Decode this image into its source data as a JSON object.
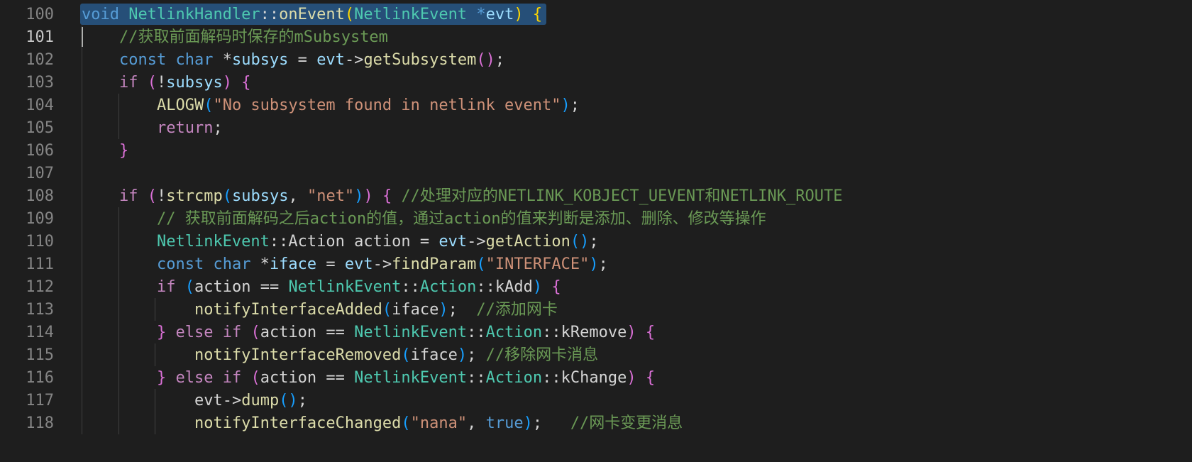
{
  "theme": {
    "background": "#1e1e1e",
    "line_number": "#858585",
    "line_number_active": "#c6c6c6",
    "selection": "#264f78",
    "keyword": "#569cd6",
    "control": "#c586c0",
    "type": "#4ec9b0",
    "function": "#dcdcaa",
    "variable": "#9cdcfe",
    "string": "#ce9178",
    "comment": "#6a9955",
    "bracket_1": "#ffd700",
    "bracket_2": "#da70d6",
    "bracket_3": "#179fff"
  },
  "editor": {
    "active_line": "101",
    "selected_line": "100",
    "lines": [
      {
        "number": "100",
        "tokens": [
          {
            "t": "void",
            "c": "kw"
          },
          {
            "t": " ",
            "c": "pl"
          },
          {
            "t": "NetlinkHandler",
            "c": "ty"
          },
          {
            "t": "::",
            "c": "pl"
          },
          {
            "t": "onEvent",
            "c": "fn"
          },
          {
            "t": "(",
            "c": "b1"
          },
          {
            "t": "NetlinkEvent",
            "c": "ty"
          },
          {
            "t": " ",
            "c": "pl"
          },
          {
            "t": "*",
            "c": "kw"
          },
          {
            "t": "evt",
            "c": "id"
          },
          {
            "t": ")",
            "c": "b1"
          },
          {
            "t": " ",
            "c": "pl"
          },
          {
            "t": "{",
            "c": "b1"
          }
        ]
      },
      {
        "number": "101",
        "tokens": [
          {
            "t": "    ",
            "c": "pl"
          },
          {
            "t": "//获取前面解码时保存的mSubsystem",
            "c": "com"
          }
        ]
      },
      {
        "number": "102",
        "tokens": [
          {
            "t": "    ",
            "c": "pl"
          },
          {
            "t": "const",
            "c": "kw"
          },
          {
            "t": " ",
            "c": "pl"
          },
          {
            "t": "char",
            "c": "kw"
          },
          {
            "t": " *",
            "c": "pl"
          },
          {
            "t": "subsys",
            "c": "id"
          },
          {
            "t": " = ",
            "c": "pl"
          },
          {
            "t": "evt",
            "c": "id"
          },
          {
            "t": "->",
            "c": "pl"
          },
          {
            "t": "getSubsystem",
            "c": "fn"
          },
          {
            "t": "()",
            "c": "b2"
          },
          {
            "t": ";",
            "c": "pl"
          }
        ]
      },
      {
        "number": "103",
        "tokens": [
          {
            "t": "    ",
            "c": "pl"
          },
          {
            "t": "if",
            "c": "ctl"
          },
          {
            "t": " ",
            "c": "pl"
          },
          {
            "t": "(",
            "c": "b2"
          },
          {
            "t": "!",
            "c": "pl"
          },
          {
            "t": "subsys",
            "c": "id"
          },
          {
            "t": ")",
            "c": "b2"
          },
          {
            "t": " ",
            "c": "pl"
          },
          {
            "t": "{",
            "c": "b2"
          }
        ]
      },
      {
        "number": "104",
        "tokens": [
          {
            "t": "        ",
            "c": "pl"
          },
          {
            "t": "ALOGW",
            "c": "fn"
          },
          {
            "t": "(",
            "c": "b3"
          },
          {
            "t": "\"No subsystem found in netlink event\"",
            "c": "str"
          },
          {
            "t": ")",
            "c": "b3"
          },
          {
            "t": ";",
            "c": "pl"
          }
        ]
      },
      {
        "number": "105",
        "tokens": [
          {
            "t": "        ",
            "c": "pl"
          },
          {
            "t": "return",
            "c": "ctl"
          },
          {
            "t": ";",
            "c": "pl"
          }
        ]
      },
      {
        "number": "106",
        "tokens": [
          {
            "t": "    ",
            "c": "pl"
          },
          {
            "t": "}",
            "c": "b2"
          }
        ]
      },
      {
        "number": "107",
        "tokens": []
      },
      {
        "number": "108",
        "tokens": [
          {
            "t": "    ",
            "c": "pl"
          },
          {
            "t": "if",
            "c": "ctl"
          },
          {
            "t": " ",
            "c": "pl"
          },
          {
            "t": "(",
            "c": "b2"
          },
          {
            "t": "!",
            "c": "pl"
          },
          {
            "t": "strcmp",
            "c": "fn"
          },
          {
            "t": "(",
            "c": "b3"
          },
          {
            "t": "subsys",
            "c": "id"
          },
          {
            "t": ", ",
            "c": "pl"
          },
          {
            "t": "\"net\"",
            "c": "str"
          },
          {
            "t": ")",
            "c": "b3"
          },
          {
            "t": ")",
            "c": "b2"
          },
          {
            "t": " ",
            "c": "pl"
          },
          {
            "t": "{",
            "c": "b2"
          },
          {
            "t": " ",
            "c": "pl"
          },
          {
            "t": "//处理对应的NETLINK_KOBJECT_UEVENT和NETLINK_ROUTE",
            "c": "com"
          }
        ]
      },
      {
        "number": "109",
        "tokens": [
          {
            "t": "        ",
            "c": "pl"
          },
          {
            "t": "// 获取前面解码之后action的值，通过action的值来判断是添加、删除、修改等操作",
            "c": "com"
          }
        ]
      },
      {
        "number": "110",
        "tokens": [
          {
            "t": "        ",
            "c": "pl"
          },
          {
            "t": "NetlinkEvent",
            "c": "ty"
          },
          {
            "t": "::",
            "c": "pl"
          },
          {
            "t": "Action",
            "c": "pl"
          },
          {
            "t": " ",
            "c": "pl"
          },
          {
            "t": "action",
            "c": "pl"
          },
          {
            "t": " = ",
            "c": "pl"
          },
          {
            "t": "evt",
            "c": "id"
          },
          {
            "t": "->",
            "c": "pl"
          },
          {
            "t": "getAction",
            "c": "fn"
          },
          {
            "t": "()",
            "c": "b3"
          },
          {
            "t": ";",
            "c": "pl"
          }
        ]
      },
      {
        "number": "111",
        "tokens": [
          {
            "t": "        ",
            "c": "pl"
          },
          {
            "t": "const",
            "c": "kw"
          },
          {
            "t": " ",
            "c": "pl"
          },
          {
            "t": "char",
            "c": "kw"
          },
          {
            "t": " *",
            "c": "pl"
          },
          {
            "t": "iface",
            "c": "id"
          },
          {
            "t": " = ",
            "c": "pl"
          },
          {
            "t": "evt",
            "c": "id"
          },
          {
            "t": "->",
            "c": "pl"
          },
          {
            "t": "findParam",
            "c": "fn"
          },
          {
            "t": "(",
            "c": "b3"
          },
          {
            "t": "\"INTERFACE\"",
            "c": "str"
          },
          {
            "t": ")",
            "c": "b3"
          },
          {
            "t": ";",
            "c": "pl"
          }
        ]
      },
      {
        "number": "112",
        "tokens": [
          {
            "t": "        ",
            "c": "pl"
          },
          {
            "t": "if",
            "c": "ctl"
          },
          {
            "t": " ",
            "c": "pl"
          },
          {
            "t": "(",
            "c": "b3"
          },
          {
            "t": "action",
            "c": "pl"
          },
          {
            "t": " == ",
            "c": "pl"
          },
          {
            "t": "NetlinkEvent",
            "c": "ty"
          },
          {
            "t": "::",
            "c": "pl"
          },
          {
            "t": "Action",
            "c": "ty"
          },
          {
            "t": "::",
            "c": "pl"
          },
          {
            "t": "kAdd",
            "c": "pl"
          },
          {
            "t": ")",
            "c": "b3"
          },
          {
            "t": " ",
            "c": "pl"
          },
          {
            "t": "{",
            "c": "b2"
          }
        ]
      },
      {
        "number": "113",
        "tokens": [
          {
            "t": "            ",
            "c": "pl"
          },
          {
            "t": "notifyInterfaceAdded",
            "c": "fn"
          },
          {
            "t": "(",
            "c": "b3"
          },
          {
            "t": "iface",
            "c": "pl"
          },
          {
            "t": ")",
            "c": "b3"
          },
          {
            "t": ";  ",
            "c": "pl"
          },
          {
            "t": "//添加网卡",
            "c": "com"
          }
        ]
      },
      {
        "number": "114",
        "tokens": [
          {
            "t": "        ",
            "c": "pl"
          },
          {
            "t": "}",
            "c": "b2"
          },
          {
            "t": " ",
            "c": "pl"
          },
          {
            "t": "else",
            "c": "ctl"
          },
          {
            "t": " ",
            "c": "pl"
          },
          {
            "t": "if",
            "c": "ctl"
          },
          {
            "t": " ",
            "c": "pl"
          },
          {
            "t": "(",
            "c": "b2"
          },
          {
            "t": "action",
            "c": "pl"
          },
          {
            "t": " == ",
            "c": "pl"
          },
          {
            "t": "NetlinkEvent",
            "c": "ty"
          },
          {
            "t": "::",
            "c": "pl"
          },
          {
            "t": "Action",
            "c": "ty"
          },
          {
            "t": "::",
            "c": "pl"
          },
          {
            "t": "kRemove",
            "c": "pl"
          },
          {
            "t": ")",
            "c": "b2"
          },
          {
            "t": " ",
            "c": "pl"
          },
          {
            "t": "{",
            "c": "b2"
          }
        ]
      },
      {
        "number": "115",
        "tokens": [
          {
            "t": "            ",
            "c": "pl"
          },
          {
            "t": "notifyInterfaceRemoved",
            "c": "fn"
          },
          {
            "t": "(",
            "c": "b3"
          },
          {
            "t": "iface",
            "c": "pl"
          },
          {
            "t": ")",
            "c": "b3"
          },
          {
            "t": "; ",
            "c": "pl"
          },
          {
            "t": "//移除网卡消息",
            "c": "com"
          }
        ]
      },
      {
        "number": "116",
        "tokens": [
          {
            "t": "        ",
            "c": "pl"
          },
          {
            "t": "}",
            "c": "b2"
          },
          {
            "t": " ",
            "c": "pl"
          },
          {
            "t": "else",
            "c": "ctl"
          },
          {
            "t": " ",
            "c": "pl"
          },
          {
            "t": "if",
            "c": "ctl"
          },
          {
            "t": " ",
            "c": "pl"
          },
          {
            "t": "(",
            "c": "b2"
          },
          {
            "t": "action",
            "c": "pl"
          },
          {
            "t": " == ",
            "c": "pl"
          },
          {
            "t": "NetlinkEvent",
            "c": "ty"
          },
          {
            "t": "::",
            "c": "pl"
          },
          {
            "t": "Action",
            "c": "ty"
          },
          {
            "t": "::",
            "c": "pl"
          },
          {
            "t": "kChange",
            "c": "pl"
          },
          {
            "t": ")",
            "c": "b2"
          },
          {
            "t": " ",
            "c": "pl"
          },
          {
            "t": "{",
            "c": "b2"
          }
        ]
      },
      {
        "number": "117",
        "tokens": [
          {
            "t": "            ",
            "c": "pl"
          },
          {
            "t": "evt",
            "c": "pl"
          },
          {
            "t": "->",
            "c": "pl"
          },
          {
            "t": "dump",
            "c": "fn"
          },
          {
            "t": "()",
            "c": "b3"
          },
          {
            "t": ";",
            "c": "pl"
          }
        ]
      },
      {
        "number": "118",
        "tokens": [
          {
            "t": "            ",
            "c": "pl"
          },
          {
            "t": "notifyInterfaceChanged",
            "c": "fn"
          },
          {
            "t": "(",
            "c": "b3"
          },
          {
            "t": "\"nana\"",
            "c": "str"
          },
          {
            "t": ", ",
            "c": "pl"
          },
          {
            "t": "true",
            "c": "kw"
          },
          {
            "t": ")",
            "c": "b3"
          },
          {
            "t": ";   ",
            "c": "pl"
          },
          {
            "t": "//网卡变更消息",
            "c": "com"
          }
        ]
      }
    ]
  }
}
